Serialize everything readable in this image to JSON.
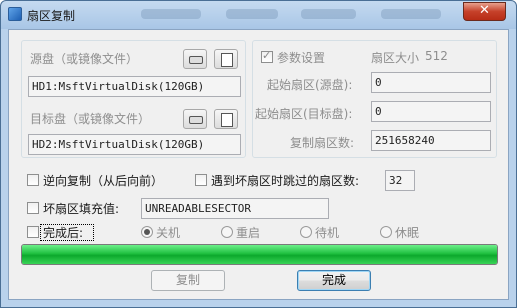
{
  "window": {
    "title": "扇区复制",
    "close_symbol": "✕"
  },
  "source": {
    "label": "源盘（或镜像文件）",
    "value": "HD1:MsftVirtualDisk(120GB)"
  },
  "target": {
    "label": "目标盘（或镜像文件）",
    "value": "HD2:MsftVirtualDisk(120GB)"
  },
  "params": {
    "checkbox_label": "参数设置",
    "checked": true,
    "sector_size_label": "扇区大小",
    "sector_size_value": "512",
    "start_src_label": "起始扇区(源盘):",
    "start_src_value": "0",
    "start_dst_label": "起始扇区(目标盘):",
    "start_dst_value": "0",
    "count_label": "复制扇区数:",
    "count_value": "251658240"
  },
  "options": {
    "reverse_label": "逆向复制（从后向前）",
    "skip_label": "遇到坏扇区时跳过的扇区数:",
    "skip_value": "32",
    "fill_label": "坏扇区填充值:",
    "fill_value": "UNREADABLESECTOR",
    "after_label": "完成后:",
    "after_choices": [
      "关机",
      "重启",
      "待机",
      "休眠"
    ],
    "after_selected": "关机"
  },
  "progress": {
    "percent": 100
  },
  "buttons": {
    "copy": "复制",
    "done": "完成"
  },
  "icons": {
    "title": "window-app-icon",
    "disk": "disk-icon",
    "file": "file-icon"
  }
}
